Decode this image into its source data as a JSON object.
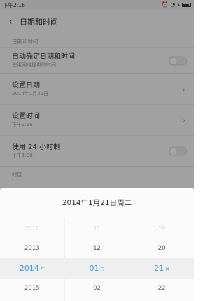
{
  "status_bar": {
    "time": "下午2:16",
    "icons": [
      "alarm-icon",
      "wifi-icon",
      "signal-icon",
      "battery-icon"
    ]
  },
  "header": {
    "title": "日期和时间"
  },
  "section_date_time": "日期和时间",
  "settings": {
    "auto": {
      "title": "自动确定日期和时间",
      "sub": "使用网络提供的时间"
    },
    "set_date": {
      "title": "设置日期",
      "sub": "2014年1月21日"
    },
    "set_time": {
      "title": "设置时间",
      "sub": "下午2:16"
    },
    "use24": {
      "title": "使用 24 小时制",
      "sub": "下午1:00"
    }
  },
  "section_timezone": "时区",
  "dialog": {
    "title": "2014年1月21日周二",
    "year": {
      "above2": "2012",
      "above1": "2013",
      "selected": "2014",
      "unit": "年",
      "below1": "2015"
    },
    "month": {
      "above2": "11",
      "above1": "12",
      "selected": "01",
      "unit": "月",
      "below1": "02"
    },
    "day": {
      "above2": "19",
      "above1": "20",
      "selected": "21",
      "unit": "日",
      "below1": "22"
    }
  },
  "colors": {
    "accent": "#2f9fe0",
    "overlay": "rgba(0,0,0,0.35)"
  }
}
